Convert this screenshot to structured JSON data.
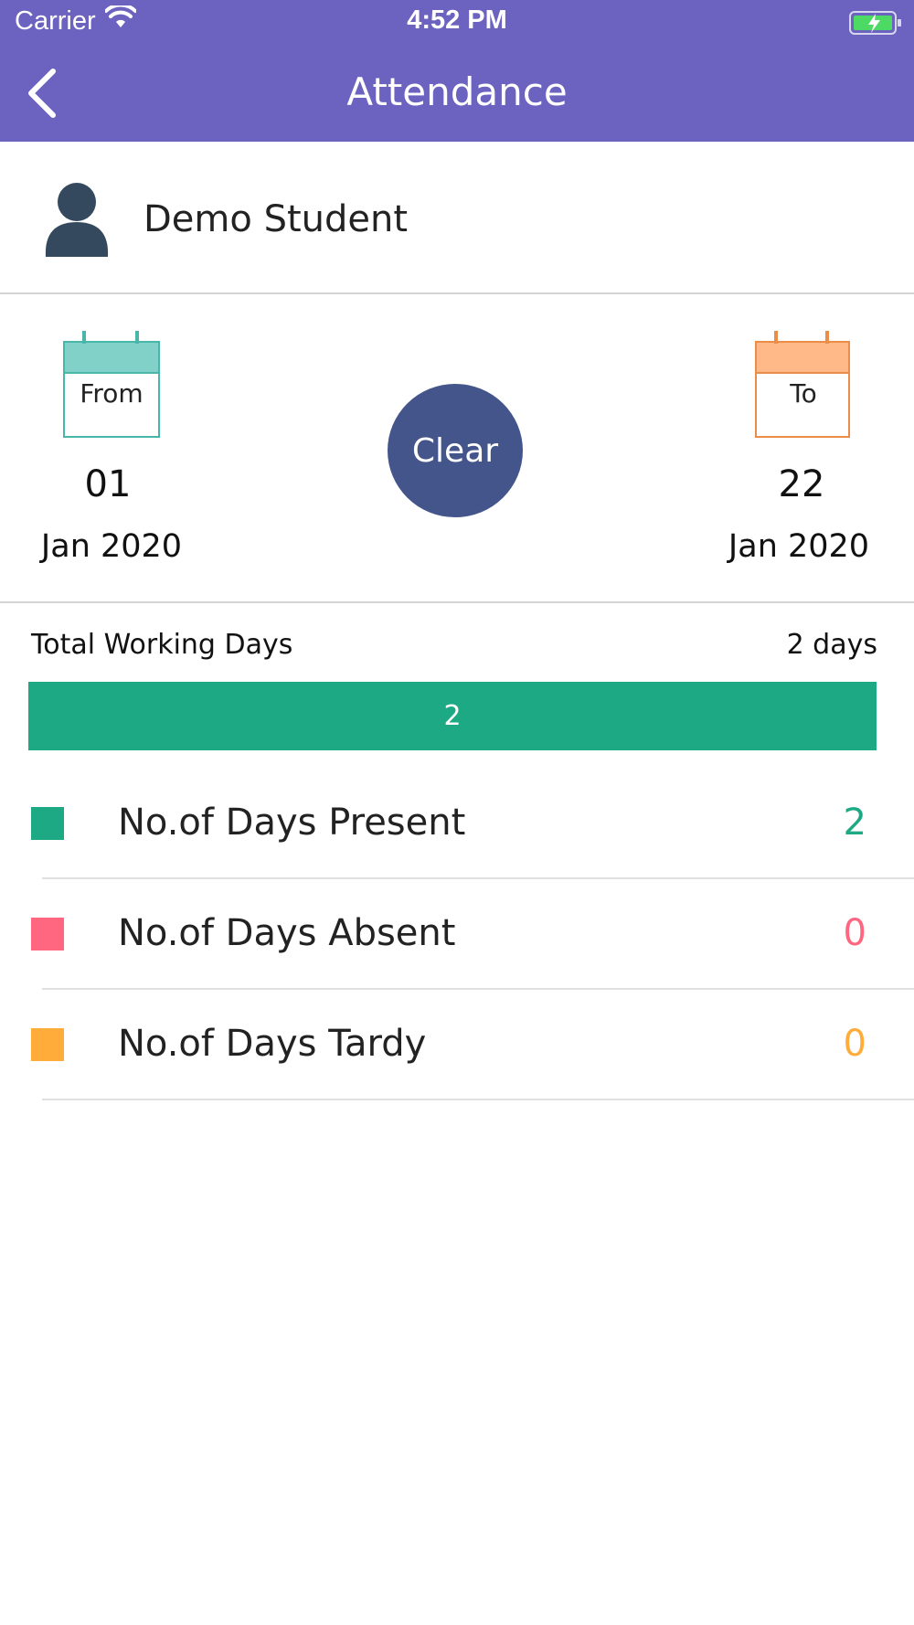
{
  "status_bar": {
    "carrier": "Carrier",
    "time": "4:52 PM"
  },
  "header": {
    "title": "Attendance",
    "back_icon": "chevron-left-icon",
    "background": "#6b63bf"
  },
  "student": {
    "name": "Demo Student",
    "avatar_icon": "person-icon"
  },
  "date_range": {
    "from": {
      "label": "From",
      "day": "01",
      "month_year": "Jan 2020",
      "color": "#82d1c8"
    },
    "to": {
      "label": "To",
      "day": "22",
      "month_year": "Jan 2020",
      "color": "#ffb888"
    },
    "clear_label": "Clear"
  },
  "working_days": {
    "label": "Total Working Days",
    "value": "2 days",
    "bar_value": "2",
    "bar_fraction": 1.0,
    "bar_color": "#1ea985"
  },
  "stats": [
    {
      "label": "No.of Days Present",
      "value": "2",
      "color": "#1ea985"
    },
    {
      "label": "No.of Days Absent",
      "value": "0",
      "color": "#ff6780"
    },
    {
      "label": "No.of Days Tardy",
      "value": "0",
      "color": "#ffac3b"
    }
  ]
}
